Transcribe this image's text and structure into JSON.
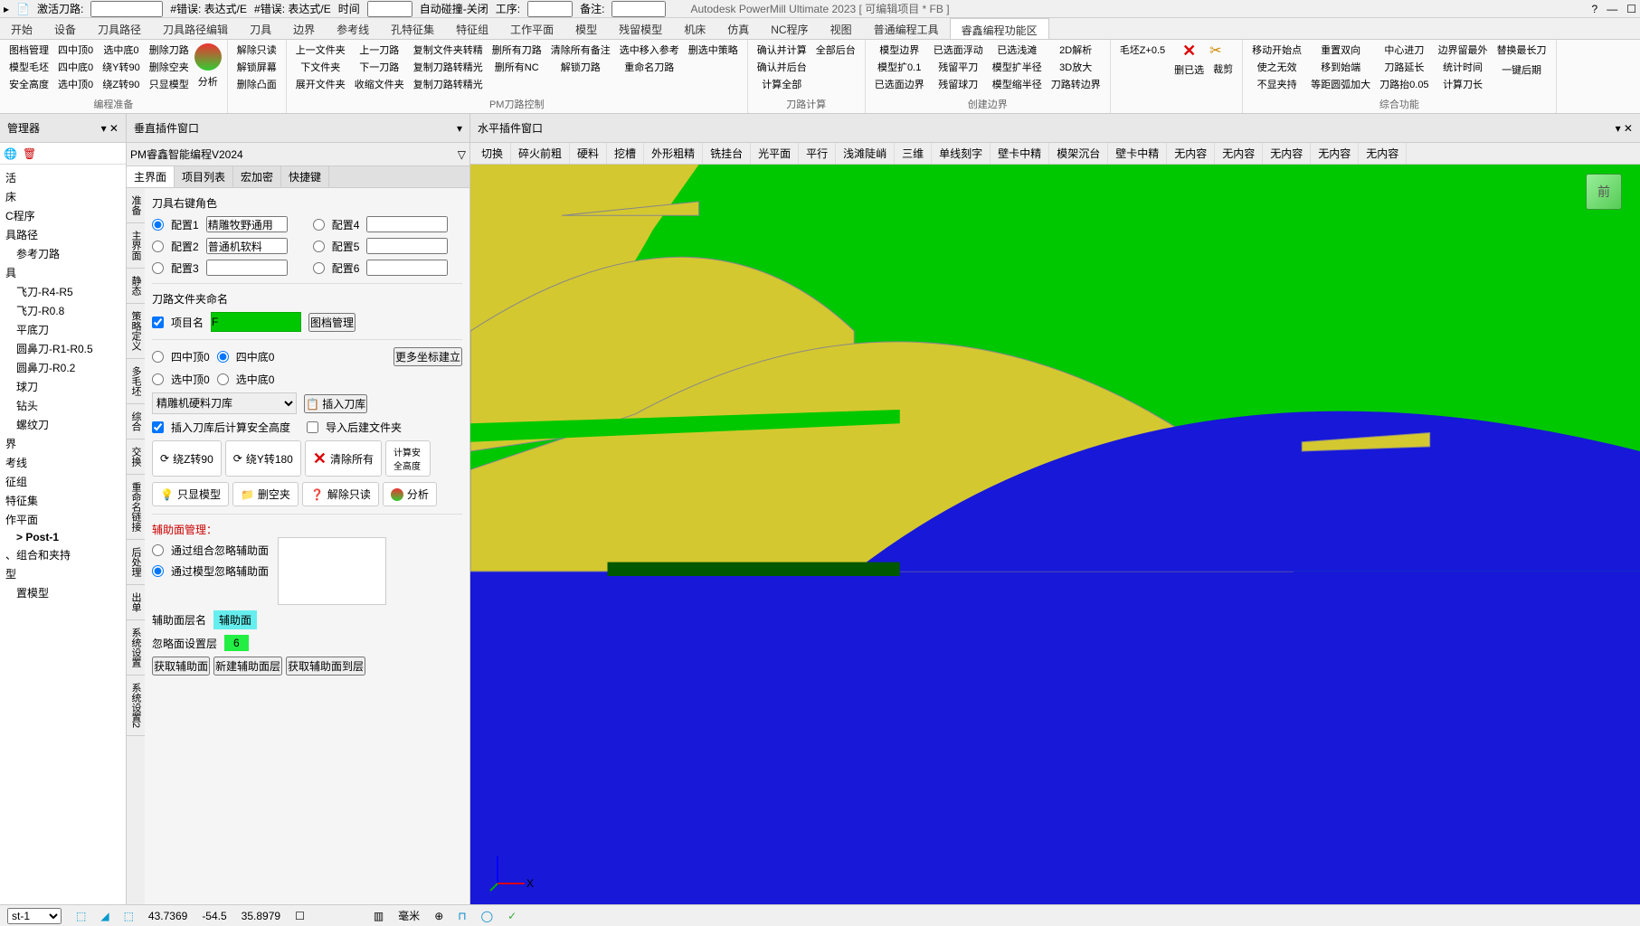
{
  "titlebar": {
    "activate_label": "激活刀路:",
    "fields": [
      {
        "label": "#错误: 表达式/E"
      },
      {
        "label": "#错误: 表达式/E"
      },
      {
        "label": "时间"
      },
      {
        "label": "自动碰撞-关闭"
      },
      {
        "label": "工序:"
      },
      {
        "label": "备注:"
      }
    ],
    "app_title": "Autodesk PowerMill Ultimate 2023    [ 可编辑项目 * FB ]"
  },
  "ribbon_tabs": [
    "开始",
    "设备",
    "刀具路径",
    "刀具路径编辑",
    "刀具",
    "边界",
    "参考线",
    "孔特征集",
    "特征组",
    "工作平面",
    "模型",
    "残留模型",
    "机床",
    "仿真",
    "NC程序",
    "视图",
    "普通编程工具",
    "睿鑫编程功能区"
  ],
  "ribbon_active_tab": "睿鑫编程功能区",
  "ribbon_groups": [
    {
      "label": "编程准备",
      "buttons": [
        [
          "图档管理",
          "模型毛坯",
          "安全高度"
        ],
        [
          "四中顶0",
          "四中底0",
          "选中顶0"
        ],
        [
          "选中底0",
          "绕Y转90",
          "绕Z转90"
        ],
        [
          "删除刀路",
          "删除空夹",
          "只显模型"
        ]
      ],
      "has_icon": true,
      "icon_label": "分析",
      "icon_color": "linear-gradient(#e33,#3c3)"
    },
    {
      "label": "",
      "buttons": [
        [
          "解除只读",
          "解锁屏幕",
          "删除凸面"
        ]
      ]
    },
    {
      "label": "PM刀路控制",
      "buttons": [
        [
          "上一文件夹",
          "下文件夹",
          "展开文件夹"
        ],
        [
          "上一刀路",
          "下一刀路",
          "收缩文件夹"
        ],
        [
          "复制文件夹转精",
          "复制刀路转精光",
          "复制刀路转精光"
        ],
        [
          "删所有刀路",
          "删所有NC",
          ""
        ],
        [
          "清除所有备注",
          "解锁刀路",
          ""
        ],
        [
          "选中移入参考",
          "重命名刀路",
          ""
        ],
        [
          "删选中策略",
          "",
          ""
        ]
      ]
    },
    {
      "label": "刀路计算",
      "buttons": [
        [
          "确认并计算",
          "确认并后台",
          "计算全部"
        ],
        [
          "全部后台",
          "",
          ""
        ]
      ]
    },
    {
      "label": "创建边界",
      "buttons": [
        [
          "模型边界",
          "模型扩0.1",
          "已选面边界"
        ],
        [
          "已选面浮动",
          "残留平刀",
          "残留球刀"
        ],
        [
          "已选浅滩",
          "模型扩半径",
          "模型缩半径"
        ],
        [
          "2D解析",
          "3D放大",
          "刀路转边界"
        ]
      ]
    },
    {
      "label": "",
      "buttons": [
        [
          "毛坯Z+0.5",
          "",
          ""
        ]
      ],
      "has_x": true,
      "x_label": "删已选",
      "x2_label": "裁剪"
    },
    {
      "label": "综合功能",
      "buttons": [
        [
          "移动开始点",
          "使之无效",
          "不显夹持"
        ],
        [
          "重置双向",
          "移到始端",
          "等距圆弧加大"
        ],
        [
          "中心进刀",
          "刀路延长",
          "刀路抬0.05"
        ],
        [
          "边界留最外",
          "统计时间",
          "计算刀长"
        ],
        [
          "替换最长刀",
          "",
          "一键后期"
        ]
      ]
    }
  ],
  "left_panel": {
    "title": "管理器",
    "tree": [
      {
        "label": "活"
      },
      {
        "label": "床"
      },
      {
        "label": "C程序"
      },
      {
        "label": "具路径"
      },
      {
        "label": "参考刀路",
        "indent": true,
        "icon": "green"
      },
      {
        "label": "具"
      },
      {
        "label": "飞刀-R4-R5",
        "indent": true
      },
      {
        "label": "飞刀-R0.8",
        "indent": true
      },
      {
        "label": "平底刀",
        "indent": true
      },
      {
        "label": "圆鼻刀-R1-R0.5",
        "indent": true
      },
      {
        "label": "圆鼻刀-R0.2",
        "indent": true
      },
      {
        "label": "球刀",
        "indent": true
      },
      {
        "label": "钻头",
        "indent": true
      },
      {
        "label": "螺纹刀",
        "indent": true
      },
      {
        "label": "界"
      },
      {
        "label": "考线"
      },
      {
        "label": "征组"
      },
      {
        "label": "特征集"
      },
      {
        "label": "作平面"
      },
      {
        "label": "> Post-1",
        "indent": true,
        "bold": true,
        "icon": "gear"
      },
      {
        "label": "、组合和夹持"
      },
      {
        "label": "型"
      },
      {
        "label": "置模型",
        "indent": true
      }
    ]
  },
  "mid_panel": {
    "title": "垂直插件窗口",
    "subheader": "PM睿鑫智能编程V2024",
    "tabs": [
      "主界面",
      "项目列表",
      "宏加密",
      "快捷键"
    ],
    "active_tab": "主界面",
    "side_tabs": [
      "准备",
      "主界面",
      "静态",
      "策略定义",
      "多毛坯",
      "综合",
      "交换",
      "重命名链接",
      "后处理",
      "出单",
      "系统设置",
      "系统设置2"
    ],
    "section1_title": "刀具右键角色",
    "configs": [
      {
        "radio": "配置1",
        "value": "精雕牧野通用",
        "radio2": "配置4"
      },
      {
        "radio": "配置2",
        "value": "普通机软料",
        "radio2": "配置5"
      },
      {
        "radio": "配置3",
        "value": "",
        "radio2": "配置6"
      }
    ],
    "section2_title": "刀路文件夹命名",
    "project_name_label": "项目名",
    "project_name_value": "F",
    "doc_mgmt_btn": "图档管理",
    "coords": {
      "opt1": "四中顶0",
      "opt2": "四中底0",
      "opt3": "选中顶0",
      "opt4": "选中底0",
      "more_btn": "更多坐标建立"
    },
    "tool_lib_select": "精雕机硬料刀库",
    "insert_lib_btn": "插入刀库",
    "checkbox1": "插入刀库后计算安全高度",
    "checkbox2": "导入后建文件夹",
    "rotate_btns": {
      "z90": "绕Z转90",
      "y180": "绕Y转180",
      "clear": "清除所有",
      "calc": "计算安全高度"
    },
    "action_btns": {
      "show_model": "只显模型",
      "del_empty": "删空夹",
      "unlock": "解除只读",
      "analyze": "分析"
    },
    "aux_title": "辅助面管理：",
    "aux_opt1": "通过组合忽略辅助面",
    "aux_opt2": "通过模型忽略辅助面",
    "aux_layer_label": "辅助面层名",
    "aux_layer_value": "辅助面",
    "ignore_layer_label": "忽略面设置层",
    "ignore_layer_value": "6",
    "bottom_btns": [
      "获取辅助面",
      "新建辅助面层",
      "获取辅助面到层"
    ]
  },
  "right_panel": {
    "title": "水平插件窗口",
    "toolbar": [
      "切换",
      "碎火前粗",
      "硬料",
      "挖槽",
      "外形粗精",
      "铣挂台",
      "光平面",
      "平行",
      "浅滩陡峭",
      "三维",
      "单线刻字",
      "壁卡中精",
      "模架沉台",
      "壁卡中精",
      "无内容",
      "无内容",
      "无内容",
      "无内容",
      "无内容"
    ],
    "view_cube": "前",
    "axis_x": "X"
  },
  "status_bar": {
    "left_dropdown": "st-1",
    "coords": [
      "43.7369",
      "-54.5",
      "35.8979"
    ],
    "unit": "毫米"
  }
}
